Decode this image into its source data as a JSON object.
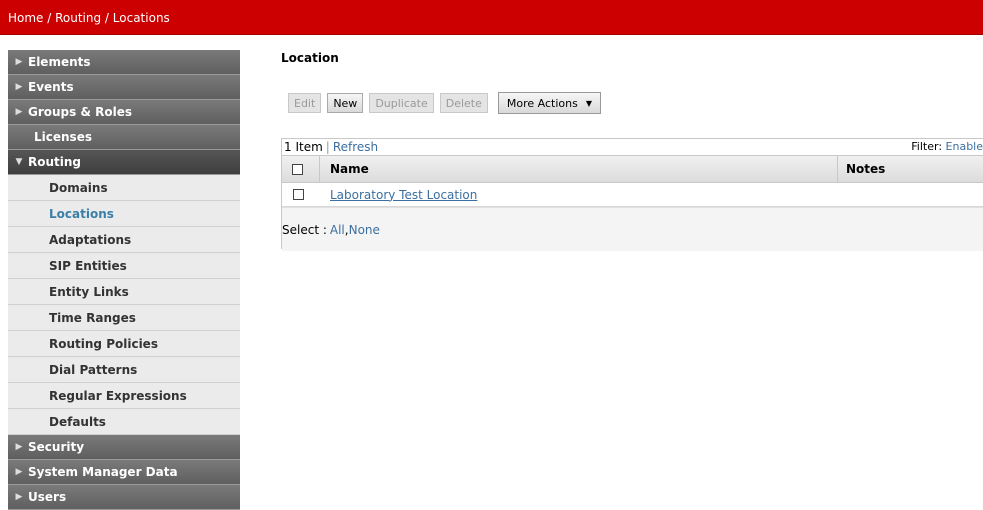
{
  "breadcrumb": "Home / Routing / Locations",
  "page_title": "Location",
  "sidebar": {
    "items": [
      {
        "label": "Elements"
      },
      {
        "label": "Events"
      },
      {
        "label": "Groups & Roles"
      },
      {
        "label": "Licenses"
      },
      {
        "label": "Routing"
      },
      {
        "label": "Security"
      },
      {
        "label": "System Manager Data"
      },
      {
        "label": "Users"
      }
    ],
    "routing_sub": [
      {
        "label": "Domains"
      },
      {
        "label": "Locations"
      },
      {
        "label": "Adaptations"
      },
      {
        "label": "SIP Entities"
      },
      {
        "label": "Entity Links"
      },
      {
        "label": "Time Ranges"
      },
      {
        "label": "Routing Policies"
      },
      {
        "label": "Dial Patterns"
      },
      {
        "label": "Regular Expressions"
      },
      {
        "label": "Defaults"
      }
    ]
  },
  "toolbar": {
    "edit": "Edit",
    "new": "New",
    "duplicate": "Duplicate",
    "delete": "Delete",
    "more_actions": "More Actions"
  },
  "table": {
    "count": "1 Item",
    "refresh": "Refresh",
    "filter_label": "Filter:",
    "filter_link": "Enable",
    "columns": [
      "Name",
      "Notes"
    ],
    "rows": [
      {
        "name": "Laboratory Test Location",
        "notes": ""
      }
    ],
    "select_label": "Select :",
    "select_all": "All",
    "select_none": "None"
  },
  "colors": {
    "topbar": "#cc0000",
    "link": "#3b6fa0",
    "active_sub": "#3b7fa8"
  }
}
